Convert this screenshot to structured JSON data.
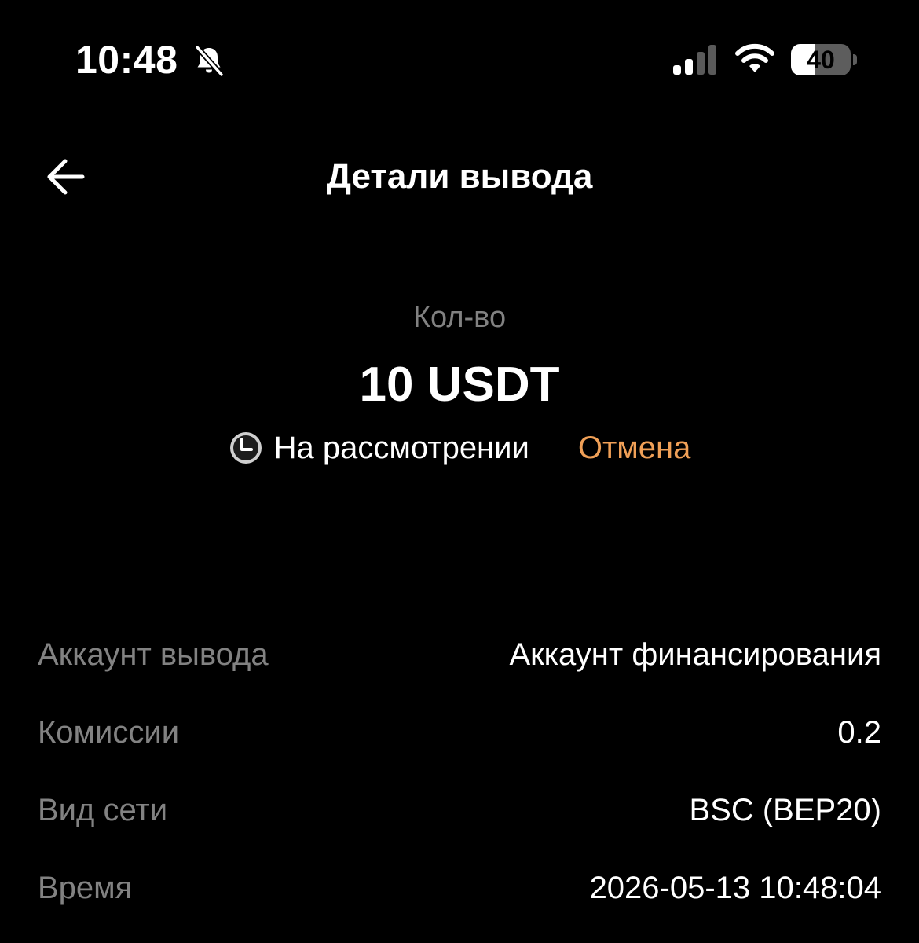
{
  "status_bar": {
    "time": "10:48",
    "silent_icon": "bell-slash-icon",
    "signal_icon": "cellular-signal-icon",
    "signal_bars": 2,
    "wifi_icon": "wifi-icon",
    "battery_level": "40",
    "battery_fraction": 0.4
  },
  "nav": {
    "back_icon": "arrow-left-icon",
    "title": "Детали вывода"
  },
  "summary": {
    "amount_label": "Кол-во",
    "amount_value": "10 USDT",
    "status_icon": "clock-icon",
    "status_text": "На рассмотрении",
    "cancel_label": "Отмена"
  },
  "details": {
    "rows": [
      {
        "label": "Аккаунт вывода",
        "value": "Аккаунт финансирования"
      },
      {
        "label": "Комиссии",
        "value": "0.2"
      },
      {
        "label": "Вид сети",
        "value": "BSC (BEP20)"
      },
      {
        "label": "Время",
        "value": "2026-05-13 10:48:04"
      }
    ]
  },
  "colors": {
    "background": "#000000",
    "primary_text": "#ffffff",
    "secondary_text": "#828282",
    "accent_cancel": "#f0a057"
  }
}
